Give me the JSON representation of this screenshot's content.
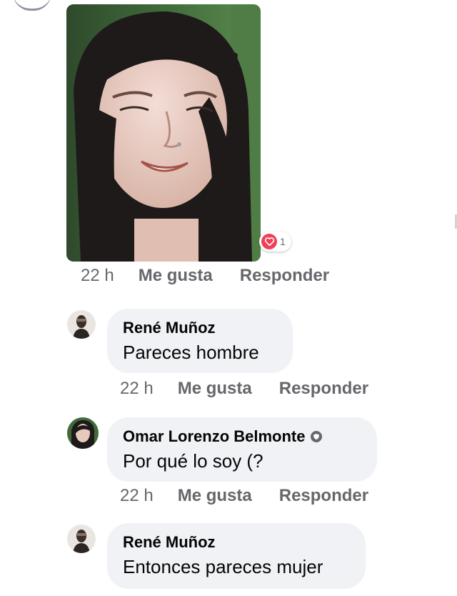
{
  "post_reply": {
    "reaction_count": "1",
    "time": "22 h",
    "like": "Me gusta",
    "reply": "Responder"
  },
  "comments": [
    {
      "author": "René Muñoz",
      "text": "Pareces hombre",
      "time": "22 h",
      "like": "Me gusta",
      "reply": "Responder"
    },
    {
      "author": "Omar Lorenzo Belmonte",
      "text": "Por qué lo soy (?",
      "time": "22 h",
      "like": "Me gusta",
      "reply": "Responder"
    },
    {
      "author": "René Muñoz",
      "text": "Entonces pareces mujer"
    }
  ],
  "colors": {
    "bubble": "#f0f2f5",
    "meta_text": "#65676b",
    "love_reaction": "#f33e58"
  },
  "icons": {
    "reaction": "heart-icon",
    "badge": "shield-icon"
  }
}
